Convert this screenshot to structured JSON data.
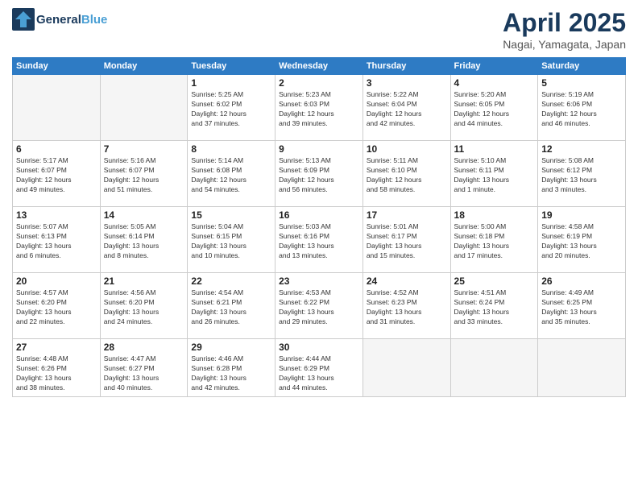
{
  "header": {
    "logo_line1": "General",
    "logo_line2": "Blue",
    "month": "April 2025",
    "location": "Nagai, Yamagata, Japan"
  },
  "weekdays": [
    "Sunday",
    "Monday",
    "Tuesday",
    "Wednesday",
    "Thursday",
    "Friday",
    "Saturday"
  ],
  "weeks": [
    [
      {
        "day": "",
        "info": ""
      },
      {
        "day": "",
        "info": ""
      },
      {
        "day": "1",
        "info": "Sunrise: 5:25 AM\nSunset: 6:02 PM\nDaylight: 12 hours\nand 37 minutes."
      },
      {
        "day": "2",
        "info": "Sunrise: 5:23 AM\nSunset: 6:03 PM\nDaylight: 12 hours\nand 39 minutes."
      },
      {
        "day": "3",
        "info": "Sunrise: 5:22 AM\nSunset: 6:04 PM\nDaylight: 12 hours\nand 42 minutes."
      },
      {
        "day": "4",
        "info": "Sunrise: 5:20 AM\nSunset: 6:05 PM\nDaylight: 12 hours\nand 44 minutes."
      },
      {
        "day": "5",
        "info": "Sunrise: 5:19 AM\nSunset: 6:06 PM\nDaylight: 12 hours\nand 46 minutes."
      }
    ],
    [
      {
        "day": "6",
        "info": "Sunrise: 5:17 AM\nSunset: 6:07 PM\nDaylight: 12 hours\nand 49 minutes."
      },
      {
        "day": "7",
        "info": "Sunrise: 5:16 AM\nSunset: 6:07 PM\nDaylight: 12 hours\nand 51 minutes."
      },
      {
        "day": "8",
        "info": "Sunrise: 5:14 AM\nSunset: 6:08 PM\nDaylight: 12 hours\nand 54 minutes."
      },
      {
        "day": "9",
        "info": "Sunrise: 5:13 AM\nSunset: 6:09 PM\nDaylight: 12 hours\nand 56 minutes."
      },
      {
        "day": "10",
        "info": "Sunrise: 5:11 AM\nSunset: 6:10 PM\nDaylight: 12 hours\nand 58 minutes."
      },
      {
        "day": "11",
        "info": "Sunrise: 5:10 AM\nSunset: 6:11 PM\nDaylight: 13 hours\nand 1 minute."
      },
      {
        "day": "12",
        "info": "Sunrise: 5:08 AM\nSunset: 6:12 PM\nDaylight: 13 hours\nand 3 minutes."
      }
    ],
    [
      {
        "day": "13",
        "info": "Sunrise: 5:07 AM\nSunset: 6:13 PM\nDaylight: 13 hours\nand 6 minutes."
      },
      {
        "day": "14",
        "info": "Sunrise: 5:05 AM\nSunset: 6:14 PM\nDaylight: 13 hours\nand 8 minutes."
      },
      {
        "day": "15",
        "info": "Sunrise: 5:04 AM\nSunset: 6:15 PM\nDaylight: 13 hours\nand 10 minutes."
      },
      {
        "day": "16",
        "info": "Sunrise: 5:03 AM\nSunset: 6:16 PM\nDaylight: 13 hours\nand 13 minutes."
      },
      {
        "day": "17",
        "info": "Sunrise: 5:01 AM\nSunset: 6:17 PM\nDaylight: 13 hours\nand 15 minutes."
      },
      {
        "day": "18",
        "info": "Sunrise: 5:00 AM\nSunset: 6:18 PM\nDaylight: 13 hours\nand 17 minutes."
      },
      {
        "day": "19",
        "info": "Sunrise: 4:58 AM\nSunset: 6:19 PM\nDaylight: 13 hours\nand 20 minutes."
      }
    ],
    [
      {
        "day": "20",
        "info": "Sunrise: 4:57 AM\nSunset: 6:20 PM\nDaylight: 13 hours\nand 22 minutes."
      },
      {
        "day": "21",
        "info": "Sunrise: 4:56 AM\nSunset: 6:20 PM\nDaylight: 13 hours\nand 24 minutes."
      },
      {
        "day": "22",
        "info": "Sunrise: 4:54 AM\nSunset: 6:21 PM\nDaylight: 13 hours\nand 26 minutes."
      },
      {
        "day": "23",
        "info": "Sunrise: 4:53 AM\nSunset: 6:22 PM\nDaylight: 13 hours\nand 29 minutes."
      },
      {
        "day": "24",
        "info": "Sunrise: 4:52 AM\nSunset: 6:23 PM\nDaylight: 13 hours\nand 31 minutes."
      },
      {
        "day": "25",
        "info": "Sunrise: 4:51 AM\nSunset: 6:24 PM\nDaylight: 13 hours\nand 33 minutes."
      },
      {
        "day": "26",
        "info": "Sunrise: 4:49 AM\nSunset: 6:25 PM\nDaylight: 13 hours\nand 35 minutes."
      }
    ],
    [
      {
        "day": "27",
        "info": "Sunrise: 4:48 AM\nSunset: 6:26 PM\nDaylight: 13 hours\nand 38 minutes."
      },
      {
        "day": "28",
        "info": "Sunrise: 4:47 AM\nSunset: 6:27 PM\nDaylight: 13 hours\nand 40 minutes."
      },
      {
        "day": "29",
        "info": "Sunrise: 4:46 AM\nSunset: 6:28 PM\nDaylight: 13 hours\nand 42 minutes."
      },
      {
        "day": "30",
        "info": "Sunrise: 4:44 AM\nSunset: 6:29 PM\nDaylight: 13 hours\nand 44 minutes."
      },
      {
        "day": "",
        "info": ""
      },
      {
        "day": "",
        "info": ""
      },
      {
        "day": "",
        "info": ""
      }
    ]
  ]
}
